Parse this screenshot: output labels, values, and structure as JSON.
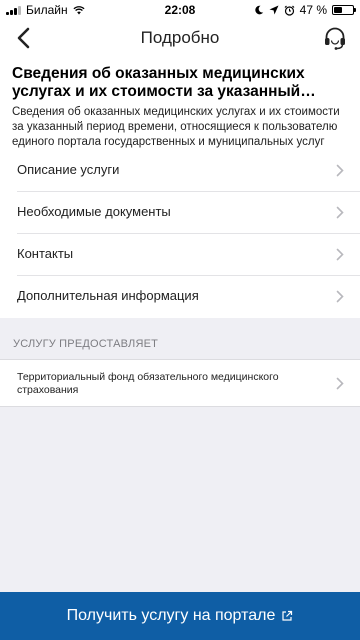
{
  "status_bar": {
    "carrier": "Билайн",
    "time": "22:08",
    "battery_percent": "47 %",
    "battery_level": 0.47
  },
  "nav": {
    "title": "Подробно",
    "back_icon": "chevron-left-icon",
    "support_icon": "headset-icon"
  },
  "service": {
    "title": "Сведения об оказанных медицинских услугах и их стоимости за указанный пери...",
    "description": "Сведения об оказанных медицинских услугах и их стоимости за указанный период времени, относящиеся к пользователю единого портала государственных и муниципальных услуг"
  },
  "menu": {
    "items": [
      {
        "label": "Описание услуги"
      },
      {
        "label": "Необходимые документы"
      },
      {
        "label": "Контакты"
      },
      {
        "label": "Дополнительная информация"
      }
    ]
  },
  "provider": {
    "section_header": "УСЛУГУ ПРЕДОСТАВЛЯЕТ",
    "name": "Территориальный фонд обязательного медицинского страхования"
  },
  "action": {
    "label": "Получить услугу на портале",
    "icon": "external-link-icon"
  },
  "colors": {
    "accent": "#0f5ea5",
    "background": "#efeff4"
  }
}
